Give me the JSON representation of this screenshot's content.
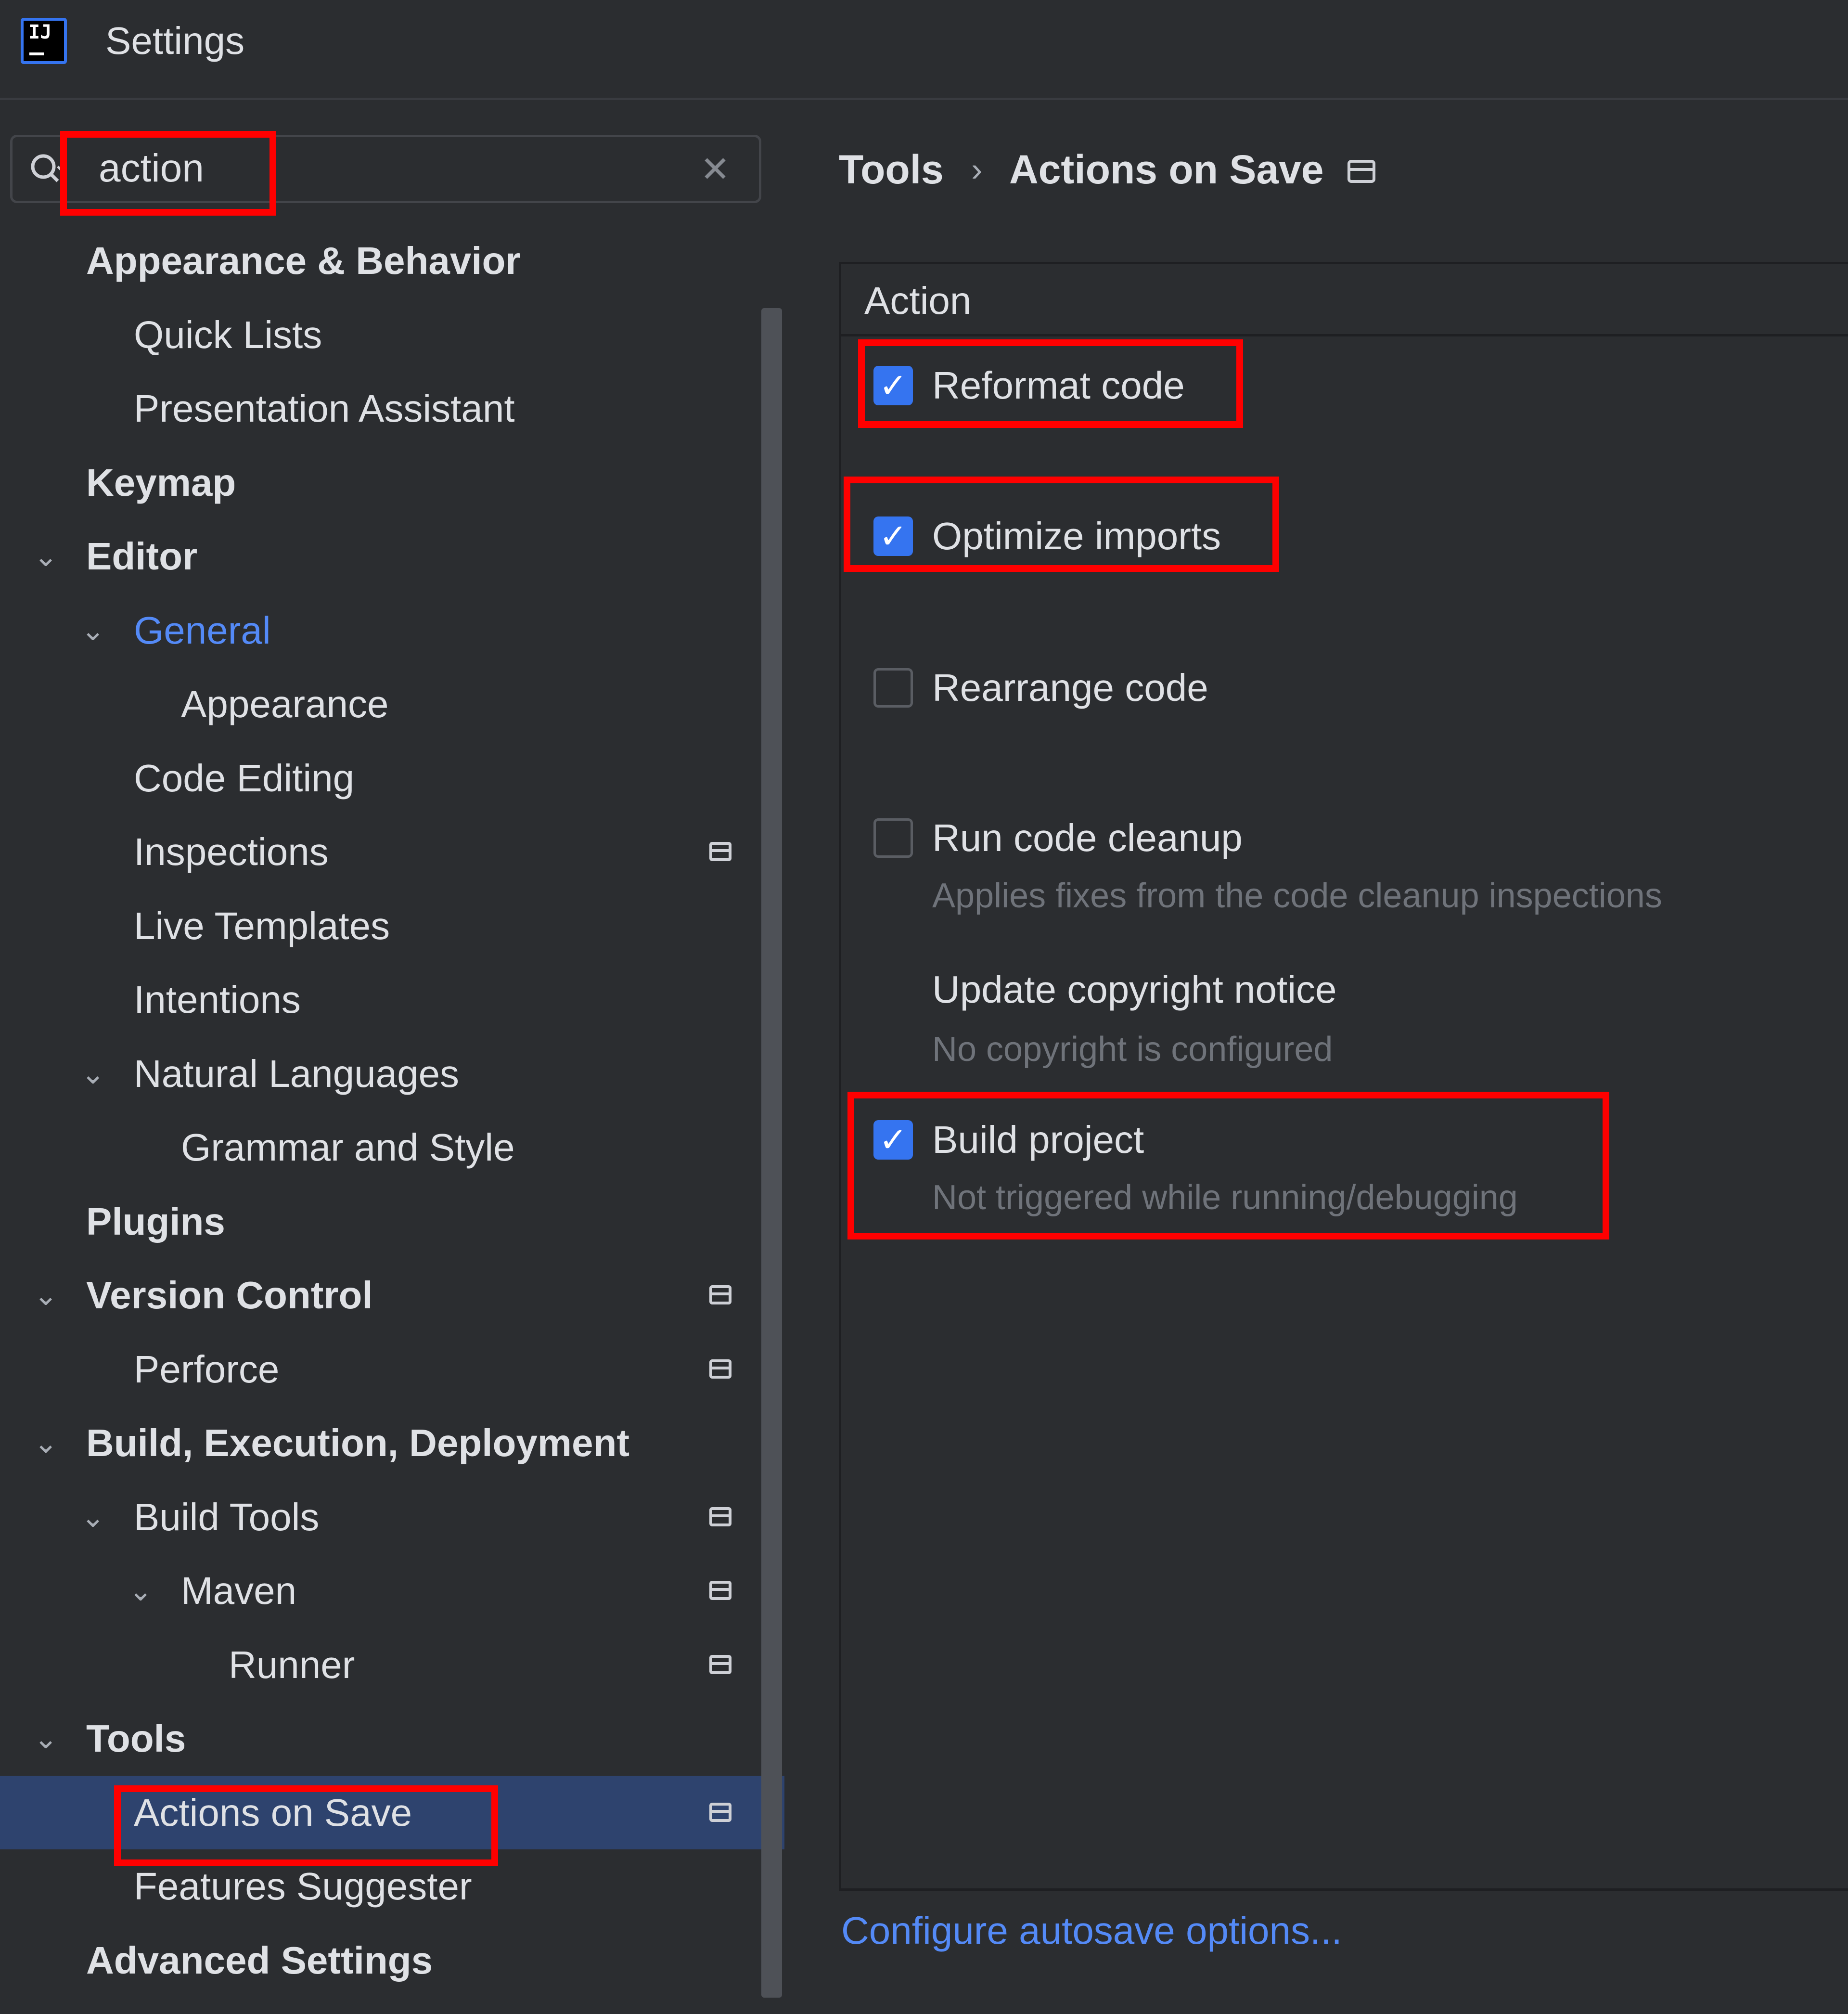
{
  "window": {
    "title": "Settings",
    "logo_text": "IJ"
  },
  "search": {
    "value": "action",
    "icon": "search-icon",
    "clear_icon": "close-icon"
  },
  "sidebar": {
    "items": [
      {
        "label": "Appearance & Behavior",
        "level": 0,
        "bold": true,
        "expandable": false,
        "project_icon": false
      },
      {
        "label": "Quick Lists",
        "level": 1,
        "bold": false,
        "expandable": false,
        "project_icon": false
      },
      {
        "label": "Presentation Assistant",
        "level": 1,
        "bold": false,
        "expandable": false,
        "project_icon": false
      },
      {
        "label": "Keymap",
        "level": 0,
        "bold": true,
        "expandable": false,
        "project_icon": false
      },
      {
        "label": "Editor",
        "level": 0,
        "bold": true,
        "expandable": true,
        "project_icon": false
      },
      {
        "label": "General",
        "level": 1,
        "bold": false,
        "expandable": true,
        "project_icon": false,
        "highlighted": true
      },
      {
        "label": "Appearance",
        "level": 2,
        "bold": false,
        "expandable": false,
        "project_icon": false
      },
      {
        "label": "Code Editing",
        "level": 1,
        "bold": false,
        "expandable": false,
        "project_icon": false
      },
      {
        "label": "Inspections",
        "level": 1,
        "bold": false,
        "expandable": false,
        "project_icon": true
      },
      {
        "label": "Live Templates",
        "level": 1,
        "bold": false,
        "expandable": false,
        "project_icon": false
      },
      {
        "label": "Intentions",
        "level": 1,
        "bold": false,
        "expandable": false,
        "project_icon": false
      },
      {
        "label": "Natural Languages",
        "level": 1,
        "bold": false,
        "expandable": true,
        "project_icon": false
      },
      {
        "label": "Grammar and Style",
        "level": 2,
        "bold": false,
        "expandable": false,
        "project_icon": false
      },
      {
        "label": "Plugins",
        "level": 0,
        "bold": true,
        "expandable": false,
        "project_icon": false
      },
      {
        "label": "Version Control",
        "level": 0,
        "bold": true,
        "expandable": true,
        "project_icon": true
      },
      {
        "label": "Perforce",
        "level": 1,
        "bold": false,
        "expandable": false,
        "project_icon": true
      },
      {
        "label": "Build, Execution, Deployment",
        "level": 0,
        "bold": true,
        "expandable": true,
        "project_icon": false
      },
      {
        "label": "Build Tools",
        "level": 1,
        "bold": false,
        "expandable": true,
        "project_icon": true
      },
      {
        "label": "Maven",
        "level": 2,
        "bold": false,
        "expandable": true,
        "project_icon": true
      },
      {
        "label": "Runner",
        "level": 3,
        "bold": false,
        "expandable": false,
        "project_icon": true
      },
      {
        "label": "Tools",
        "level": 0,
        "bold": true,
        "expandable": true,
        "project_icon": false
      },
      {
        "label": "Actions on Save",
        "level": 1,
        "bold": false,
        "expandable": false,
        "project_icon": true,
        "selected": true
      },
      {
        "label": "Features Suggester",
        "level": 1,
        "bold": false,
        "expandable": false,
        "project_icon": false
      },
      {
        "label": "Advanced Settings",
        "level": 0,
        "bold": true,
        "expandable": false,
        "project_icon": false
      }
    ]
  },
  "breadcrumb": {
    "parent": "Tools",
    "separator": "›",
    "current": "Actions on Save"
  },
  "table": {
    "header": "Action",
    "options": [
      {
        "label": "Reformat code",
        "checked": true,
        "sub": ""
      },
      {
        "label": "Optimize imports",
        "checked": true,
        "sub": ""
      },
      {
        "label": "Rearrange code",
        "checked": false,
        "sub": ""
      },
      {
        "label": "Run code cleanup",
        "checked": false,
        "sub": "Applies fixes from the code cleanup inspections"
      },
      {
        "label": "Update copyright notice",
        "checked": null,
        "sub": "No copyright is configured"
      },
      {
        "label": "Build project",
        "checked": true,
        "sub": "Not triggered while running/debugging"
      }
    ]
  },
  "footer": {
    "autosave_link": "Configure autosave options..."
  },
  "colors": {
    "background": "#2b2d30",
    "accent": "#3574f0",
    "link": "#548af7",
    "selection": "#2e436e",
    "annotation": "#ff0000"
  }
}
